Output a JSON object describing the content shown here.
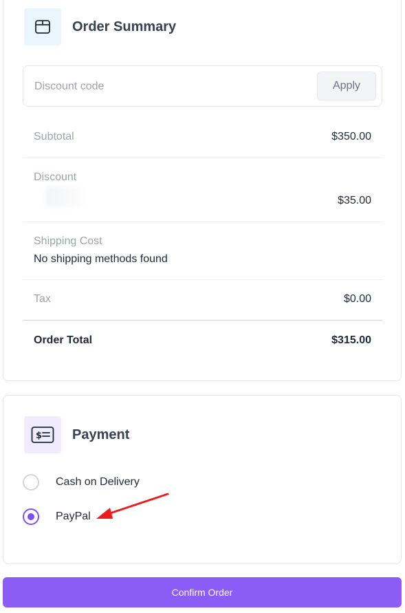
{
  "order_summary": {
    "title": "Order Summary",
    "icon": "package-icon",
    "discount": {
      "placeholder": "Discount code",
      "value": "",
      "apply_label": "Apply"
    },
    "subtotal": {
      "label": "Subtotal",
      "value": "$350.00"
    },
    "discount_row": {
      "label": "Discount",
      "value": "$35.00"
    },
    "shipping": {
      "label": "Shipping Cost",
      "message": "No shipping methods found"
    },
    "tax": {
      "label": "Tax",
      "value": "$0.00"
    },
    "total": {
      "label": "Order Total",
      "value": "$315.00"
    }
  },
  "payment": {
    "title": "Payment",
    "icon": "dollar-bill-icon",
    "options": [
      {
        "label": "Cash on Delivery",
        "selected": false
      },
      {
        "label": "PayPal",
        "selected": true
      }
    ]
  },
  "confirm": {
    "label": "Confirm Order"
  },
  "colors": {
    "accent": "#8b5cf6",
    "radio_selected": "#7c4dff",
    "annotation_arrow": "#ee1c1c"
  }
}
